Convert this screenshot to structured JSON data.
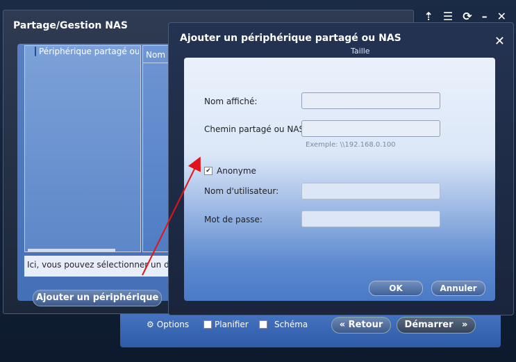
{
  "background_app": {
    "title": "Partage/Gestion NAS",
    "icons": [
      "upload-icon",
      "list-icon",
      "refresh-icon",
      "minimize-icon",
      "close-icon"
    ]
  },
  "nas_dialog": {
    "title": "Partage/Gestion NAS",
    "tree_item": "Périphérique partagé ou NAS",
    "col_name": "Nom",
    "col_size": "Taille",
    "info_text": "Ici, vous pouvez sélectionner un dossier de",
    "add_button": "Ajouter un périphérique partagé"
  },
  "add_dialog": {
    "title": "Ajouter un périphérique partagé ou NAS",
    "display_name_label": "Nom affiché:",
    "display_name_value": "",
    "share_path_label": "Chemin partagé ou NAS:",
    "share_path_value": "",
    "example_hint": "Exemple: \\\\192.168.0.100",
    "anonymous_label": "Anonyme",
    "anonymous_checked": true,
    "username_label": "Nom d'utilisateur:",
    "password_label": "Mot de passe:",
    "ok_label": "OK",
    "cancel_label": "Annuler"
  },
  "bottom_bar": {
    "options_label": "Options",
    "schedule_label": "Planifier",
    "schema_label": "Schéma",
    "back_label": "Retour",
    "start_label": "Démarrer"
  },
  "colors": {
    "annotation_arrow": "#e0141a"
  }
}
